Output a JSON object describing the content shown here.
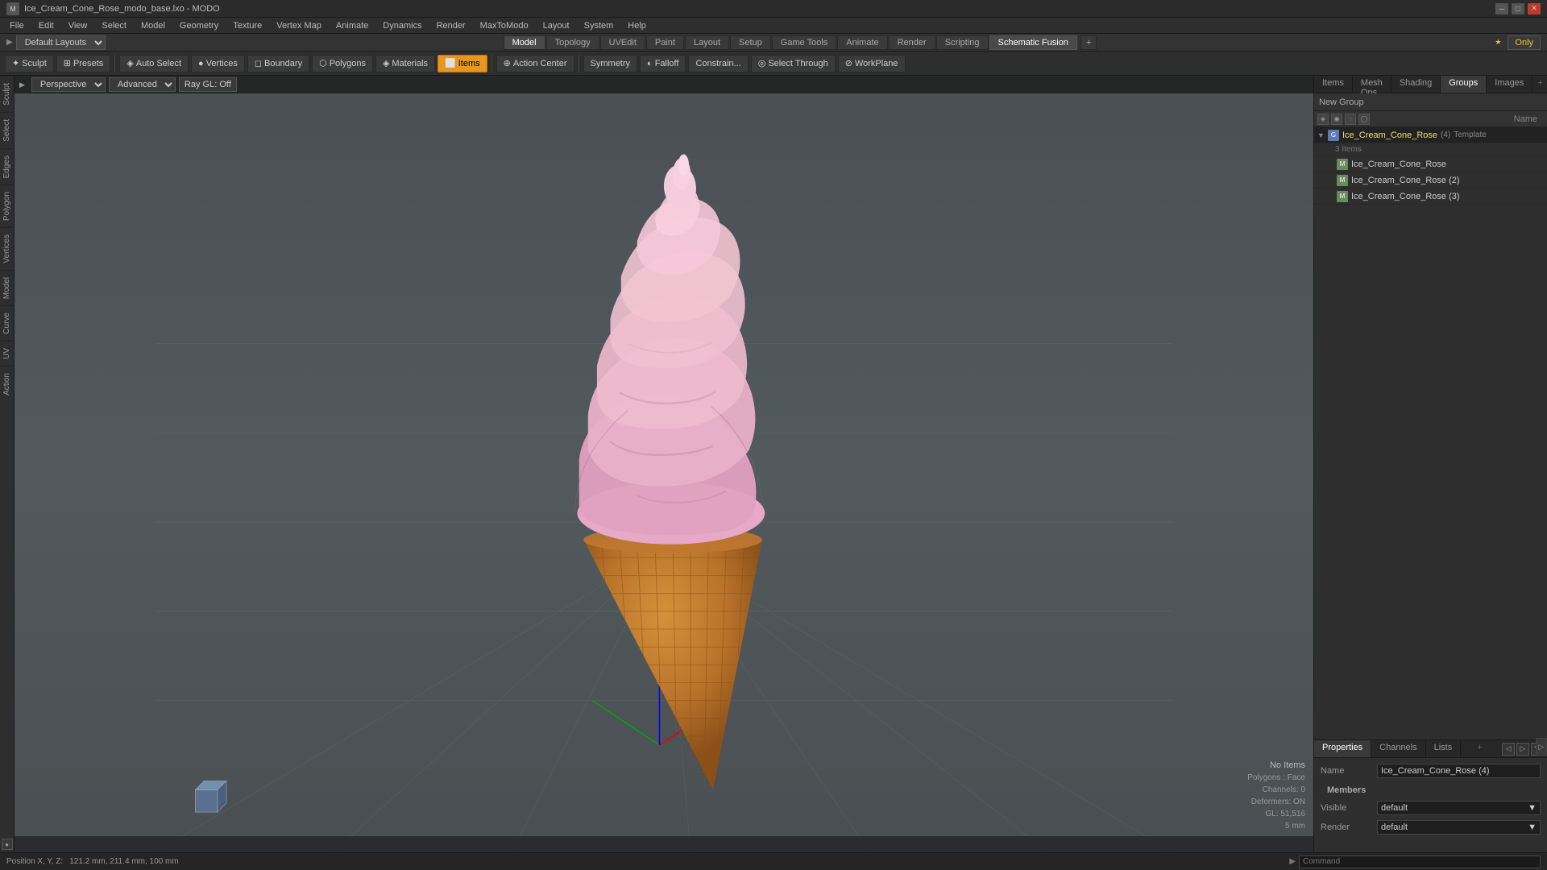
{
  "titlebar": {
    "title": "Ice_Cream_Cone_Rose_modo_base.lxo - MODO",
    "app_name": "MODO"
  },
  "menubar": {
    "items": [
      "File",
      "Edit",
      "View",
      "Select",
      "Model",
      "Geometry",
      "Texture",
      "Vertex Map",
      "Animate",
      "Dynamics",
      "Render",
      "MaxToModo",
      "Layout",
      "System",
      "Help"
    ]
  },
  "layout_bar": {
    "dropdown_label": "Default Layouts",
    "tabs": [
      "Model",
      "Topology",
      "UVEdit",
      "Paint",
      "Layout",
      "Setup",
      "Game Tools",
      "Animate",
      "Render",
      "Scripting",
      "Schematic Fusion"
    ],
    "add_tab": "+",
    "only_btn": "Only"
  },
  "toolbar": {
    "sculpt_label": "Sculpt",
    "presets_label": "Presets",
    "auto_select_label": "Auto Select",
    "vertices_label": "Vertices",
    "boundary_label": "Boundary",
    "polygons_label": "Polygons",
    "materials_label": "Materials",
    "items_label": "Items",
    "action_center_label": "Action Center",
    "symmetry_label": "Symmetry",
    "falloff_label": "Falloff",
    "constrain_label": "Constrain...",
    "select_through_label": "Select Through",
    "workplane_label": "WorkPlane"
  },
  "viewport": {
    "mode_dropdown": "Perspective",
    "shading_dropdown": "Advanced",
    "ray_gl_label": "Ray GL: Off",
    "stats": {
      "no_items_label": "No Items",
      "polygons_label": "Polygons : Face",
      "channels_label": "Channels: 0",
      "deformers_label": "Deformers: ON",
      "gl_label": "GL: 51,516",
      "mm_label": "5 mm"
    },
    "position_label": "Position X, Y, Z:",
    "position_value": "121.2 mm, 211.4 mm, 100 mm"
  },
  "sidebar_tabs": [
    "Sculpt",
    "Select",
    "Edges",
    "Polygons",
    "Vertices",
    "Model",
    "Curve",
    "UV",
    "Action"
  ],
  "right_panel": {
    "tabs": [
      "Items",
      "Mesh Ops",
      "Shading",
      "Groups",
      "Images"
    ],
    "add_tab": "+",
    "new_group_label": "New Group",
    "name_col_header": "Name",
    "groups": {
      "main_group_name": "Ice_Cream_Cone_Rose",
      "main_group_count": "(4)",
      "main_group_sublabel": "3 Items",
      "items": [
        {
          "name": "Ice_Cream_Cone_Rose",
          "type": "mesh"
        },
        {
          "name": "Ice_Cream_Cone_Rose (2)",
          "type": "mesh"
        },
        {
          "name": "Ice_Cream_Cone_Rose (3)",
          "type": "mesh"
        }
      ]
    }
  },
  "bottom_panel": {
    "tabs": [
      "Properties",
      "Channels",
      "Lists"
    ],
    "add_tab": "+",
    "members_label": "Members",
    "name_label": "Name",
    "name_value": "Ice_Cream_Cone_Rose (4)",
    "visible_label": "Visible",
    "visible_value": "default",
    "render_label": "Render",
    "render_value": "default"
  },
  "status_bar": {
    "position_label": "Position X, Y, Z:",
    "position_value": "121.2 mm, 211.4 mm, 100 mm",
    "command_placeholder": "Command"
  },
  "colors": {
    "accent_orange": "#e8961e",
    "active_tab_bg": "#3a3a3a",
    "group_selected": "#2a4a7a",
    "group_highlight": "#e0e080"
  }
}
